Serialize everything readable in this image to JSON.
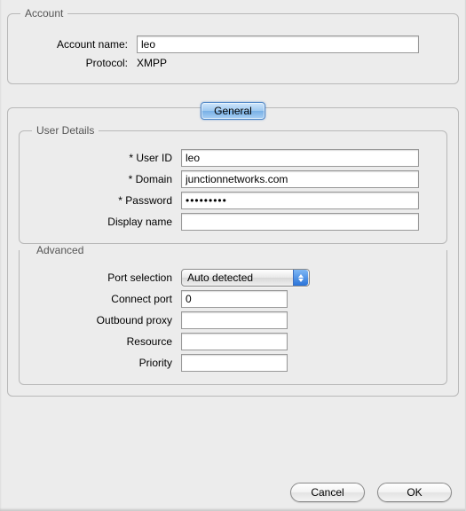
{
  "account": {
    "legend": "Account",
    "name_label": "Account name:",
    "name_value": "leo",
    "protocol_label": "Protocol:",
    "protocol_value": "XMPP"
  },
  "tabs": {
    "general": "General"
  },
  "user_details": {
    "legend": "User Details",
    "user_id_label": "* User ID",
    "user_id_value": "leo",
    "domain_label": "* Domain",
    "domain_value": "junctionnetworks.com",
    "password_label": "* Password",
    "password_value": "•••••••••",
    "display_name_label": "Display name",
    "display_name_value": ""
  },
  "advanced": {
    "legend": "Advanced",
    "port_selection_label": "Port selection",
    "port_selection_value": "Auto detected",
    "connect_port_label": "Connect port",
    "connect_port_value": "0",
    "outbound_proxy_label": "Outbound proxy",
    "outbound_proxy_value": "",
    "resource_label": "Resource",
    "resource_value": "",
    "priority_label": "Priority",
    "priority_value": ""
  },
  "buttons": {
    "cancel": "Cancel",
    "ok": "OK"
  }
}
